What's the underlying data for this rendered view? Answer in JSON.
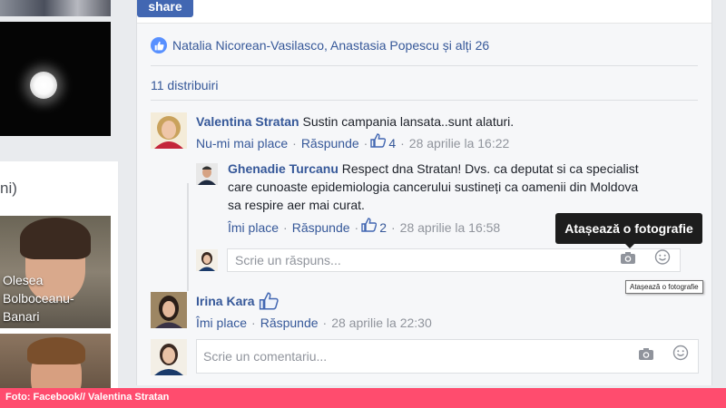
{
  "post": {
    "share_label": "share",
    "likes_text": "Natalia Nicorean-Vasilasco, Anastasia Popescu și alți 26",
    "shares_text": "11 distribuiri"
  },
  "sidebar": {
    "friends_heading_fragment": "ni)",
    "friend1_name": "Olesea Bolboceanu-Banari"
  },
  "comments": [
    {
      "author": "Valentina Stratan",
      "text": "Sustin campania lansata..sunt alaturi.",
      "like_action": "Nu-mi mai place",
      "reply_action": "Răspunde",
      "like_count": "4",
      "timestamp": "28 aprilie la 16:22",
      "replies": [
        {
          "author": "Ghenadie Turcanu",
          "text_line1": "Respect dna Stratan! Dvs. ca deputat si ca specialist",
          "text_line2": "care cunoaste epidemiologia cancerului sustineți ca oamenii din Moldova",
          "text_line3": "sa respire aer mai curat.",
          "like_action": "Îmi place",
          "reply_action": "Răspunde",
          "like_count": "2",
          "timestamp": "28 aprilie la 16:58"
        }
      ],
      "reply_placeholder": "Scrie un răspuns..."
    },
    {
      "author": "Irina Kara",
      "text": "",
      "like_action": "Îmi place",
      "reply_action": "Răspunde",
      "timestamp": "28 aprilie la 22:30"
    }
  ],
  "comment_input": {
    "placeholder": "Scrie un comentariu..."
  },
  "tooltip": {
    "label": "Atașează o fotografie",
    "native_label": "Atașează o fotografie"
  },
  "caption": "Foto: Facebook// Valentina Stratan",
  "icons": [
    "like-icon",
    "thumbs-up-icon",
    "camera-icon",
    "smiley-icon"
  ],
  "colors": {
    "link": "#365899",
    "share_button": "#4267b2",
    "caption_bar": "#ff4c6e",
    "like_badge": "#5890ff"
  }
}
